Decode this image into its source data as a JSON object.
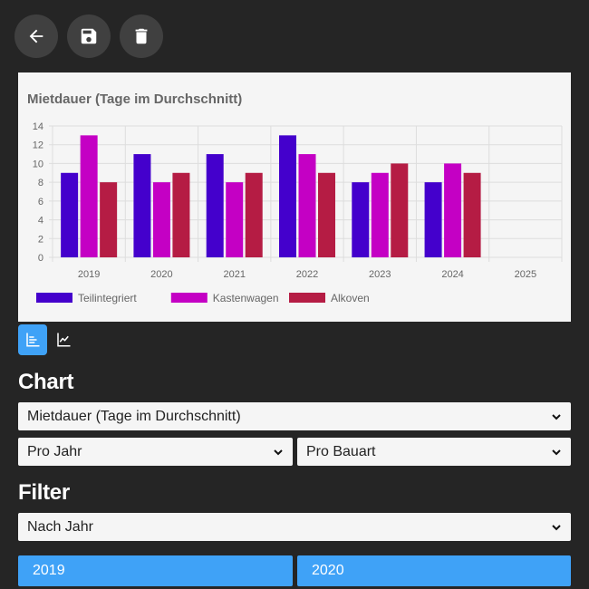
{
  "toolbar": {
    "icons": [
      "arrow-left-icon",
      "floppy-disk-icon",
      "trash-icon"
    ]
  },
  "view_toggle": {
    "active": "bar-chart",
    "icons": [
      "bar-chart-icon",
      "line-chart-icon"
    ]
  },
  "chart_section": {
    "title": "Chart",
    "metric_select": "Mietdauer (Tage im Durchschnitt)",
    "period_select": "Pro Jahr",
    "group_select": "Pro Bauart"
  },
  "filter_section": {
    "title": "Filter",
    "filter_select": "Nach Jahr",
    "years": [
      "2019",
      "2020"
    ]
  },
  "colors": {
    "accent": "#3fa2f7",
    "background": "#252525"
  },
  "chart_data": {
    "type": "bar",
    "title": "Mietdauer (Tage im Durchschnitt)",
    "categories": [
      "2019",
      "2020",
      "2021",
      "2022",
      "2023",
      "2024",
      "2025"
    ],
    "ylim": [
      0,
      14
    ],
    "yticks": [
      0,
      2,
      4,
      6,
      8,
      10,
      12,
      14
    ],
    "grid": true,
    "legend_position": "bottom-left",
    "series": [
      {
        "name": "Teilintegriert",
        "color": "#4400cc",
        "values": [
          9,
          11,
          11,
          13,
          8,
          8,
          null
        ]
      },
      {
        "name": "Kastenwagen",
        "color": "#c400c4",
        "values": [
          13,
          8,
          8,
          11,
          9,
          10,
          null
        ]
      },
      {
        "name": "Alkoven",
        "color": "#b51c44",
        "values": [
          8,
          9,
          9,
          9,
          10,
          9,
          null
        ]
      }
    ]
  }
}
